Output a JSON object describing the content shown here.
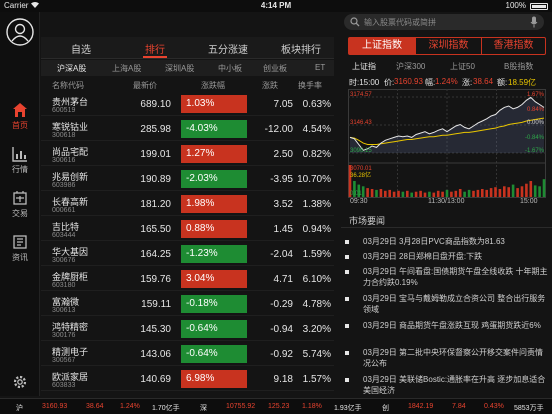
{
  "status_bar": {
    "carrier": "Carrier",
    "time": "4:14 PM",
    "battery": "100%"
  },
  "sidebar": {
    "items": [
      {
        "label": "首页",
        "icon": "home-icon",
        "active": true
      },
      {
        "label": "行情",
        "icon": "chart-icon",
        "active": false
      },
      {
        "label": "交易",
        "icon": "trade-icon",
        "active": false
      },
      {
        "label": "资讯",
        "icon": "news-icon",
        "active": false
      }
    ]
  },
  "main_tabs": [
    {
      "label": "自选",
      "active": false
    },
    {
      "label": "排行",
      "active": true
    },
    {
      "label": "五分涨速",
      "active": false
    },
    {
      "label": "板块排行",
      "active": false
    }
  ],
  "sub_tabs": [
    {
      "label": "沪深A股",
      "active": true
    },
    {
      "label": "上海A股",
      "active": false
    },
    {
      "label": "深圳A股",
      "active": false
    },
    {
      "label": "中小板",
      "active": false
    },
    {
      "label": "创业板",
      "active": false
    },
    {
      "label": "ET",
      "active": false
    }
  ],
  "columns": {
    "name": "名称代码",
    "price": "最新价",
    "change": "涨跌幅",
    "amount": "涨跌",
    "turnover": "换手率"
  },
  "stocks": [
    {
      "name": "贵州茅台",
      "code": "600519",
      "price": "689.10",
      "change": "1.03%",
      "dir": "up",
      "amount": "7.05",
      "turnover": "0.63%"
    },
    {
      "name": "寒锐钴业",
      "code": "300618",
      "price": "285.98",
      "change": "-4.03%",
      "dir": "down",
      "amount": "-12.00",
      "turnover": "4.54%"
    },
    {
      "name": "尚品宅配",
      "code": "300616",
      "price": "199.01",
      "change": "1.27%",
      "dir": "up",
      "amount": "2.50",
      "turnover": "0.82%"
    },
    {
      "name": "兆易创新",
      "code": "603986",
      "price": "190.89",
      "change": "-2.03%",
      "dir": "down",
      "amount": "-3.95",
      "turnover": "10.70%"
    },
    {
      "name": "长春高新",
      "code": "000661",
      "price": "181.20",
      "change": "1.98%",
      "dir": "up",
      "amount": "3.52",
      "turnover": "1.38%"
    },
    {
      "name": "吉比特",
      "code": "603444",
      "price": "165.50",
      "change": "0.88%",
      "dir": "up",
      "amount": "1.45",
      "turnover": "0.94%"
    },
    {
      "name": "华大基因",
      "code": "300676",
      "price": "164.25",
      "change": "-1.23%",
      "dir": "down",
      "amount": "-2.04",
      "turnover": "1.59%"
    },
    {
      "name": "金牌厨柜",
      "code": "603180",
      "price": "159.76",
      "change": "3.04%",
      "dir": "up",
      "amount": "4.71",
      "turnover": "6.10%"
    },
    {
      "name": "富瀚微",
      "code": "300613",
      "price": "159.11",
      "change": "-0.18%",
      "dir": "down",
      "amount": "-0.29",
      "turnover": "4.78%"
    },
    {
      "name": "鸿特精密",
      "code": "300176",
      "price": "145.30",
      "change": "-0.64%",
      "dir": "down",
      "amount": "-0.94",
      "turnover": "3.20%"
    },
    {
      "name": "精测电子",
      "code": "300567",
      "price": "143.06",
      "change": "-0.64%",
      "dir": "down",
      "amount": "-0.92",
      "turnover": "5.74%"
    },
    {
      "name": "欧派家居",
      "code": "603833",
      "price": "140.69",
      "change": "6.98%",
      "dir": "up",
      "amount": "9.18",
      "turnover": "1.57%"
    }
  ],
  "search": {
    "placeholder": "输入股票代码或简拼"
  },
  "index_tabs": [
    {
      "label": "上证指数",
      "active": true
    },
    {
      "label": "深圳指数",
      "active": false
    },
    {
      "label": "香港指数",
      "active": false
    }
  ],
  "index_sub": [
    {
      "label": "上证指",
      "active": true
    },
    {
      "label": "沪深300",
      "active": false
    },
    {
      "label": "上证50",
      "active": false
    },
    {
      "label": "B股指数",
      "active": false
    }
  ],
  "quote": {
    "time": "时:15:00",
    "price_label": "价:",
    "price": "3160.93",
    "rate_label": "幅:",
    "rate": "1.24%",
    "chg_label": "涨:",
    "chg": "38.64",
    "vol_label": "额:",
    "vol": "18.59亿"
  },
  "chart_data": {
    "type": "line",
    "price_levels": [
      "3174.57",
      "3146.43",
      "3096.15"
    ],
    "pct_levels": [
      "1.67%",
      "0.84%",
      "0.00%",
      "-0.84%",
      "-1.67%"
    ],
    "vol_levels": [
      "3070.01",
      "36.28亿",
      "0.01"
    ],
    "times": [
      "09:30",
      "11:30/13:00",
      "15:00"
    ],
    "price_series": [
      3118,
      3116,
      3108,
      3100,
      3102,
      3106,
      3104,
      3110,
      3114,
      3116,
      3118,
      3120,
      3119,
      3120,
      3118,
      3122,
      3124,
      3126,
      3123,
      3125,
      3128,
      3130,
      3126,
      3130,
      3134,
      3136,
      3132,
      3130,
      3134,
      3138,
      3141,
      3144,
      3148,
      3150,
      3156,
      3160,
      3162,
      3158,
      3160,
      3164,
      3170,
      3174,
      3168,
      3164,
      3160
    ],
    "avg_series": [
      3118,
      3117,
      3114,
      3110,
      3108,
      3108,
      3108,
      3109,
      3110,
      3111,
      3112,
      3113,
      3114,
      3115,
      3115,
      3116,
      3117,
      3118,
      3119,
      3119,
      3120,
      3121,
      3121,
      3122,
      3123,
      3124,
      3125,
      3125,
      3126,
      3127,
      3128,
      3129,
      3130,
      3131,
      3133,
      3134,
      3136,
      3137,
      3138,
      3139,
      3141,
      3142,
      3143,
      3144,
      3145
    ],
    "volume": [
      36,
      18,
      14,
      12,
      10,
      9,
      8,
      9,
      7,
      8,
      6,
      7,
      6,
      7,
      5,
      6,
      7,
      5,
      6,
      5,
      7,
      6,
      8,
      6,
      7,
      9,
      6,
      8,
      7,
      8,
      9,
      8,
      10,
      11,
      9,
      12,
      11,
      14,
      10,
      12,
      15,
      18,
      13,
      12,
      20
    ]
  },
  "news_header": "市场要闻",
  "news": [
    {
      "date": "03月29日",
      "text": "3月28日PVC商品指数为81.63"
    },
    {
      "date": "03月29日",
      "text": "28日郑棉日盘开盘:下跌"
    },
    {
      "date": "03月29日",
      "text": "午间看盘:国债期货午盘全线收跌 十年期主力合约跌0.19%"
    },
    {
      "date": "03月29日",
      "text": "宝马与戴姆勒成立合资公司 整合出行服务领域"
    },
    {
      "date": "03月29日",
      "text": "商品期货午盘涨跌互现 鸡蛋期货跌近6%"
    },
    {
      "date": "03月29日",
      "text": "第二批中央环保督察公开移交案件问责情况公布"
    },
    {
      "date": "03月29日",
      "text": "美联储Bostic:通胀率在升高 逐步加息适合美国经济"
    }
  ],
  "ticker": {
    "sh_label": "沪",
    "sh_price": "3160.93",
    "sh_chg": "38.64",
    "sh_pct": "1.24%",
    "sh_vol": "1.70亿手",
    "sz_label": "深",
    "sz_price": "10755.92",
    "sz_chg": "125.23",
    "sz_pct": "1.18%",
    "sz_vol": "1.93亿手",
    "cy_label": "创",
    "cy_price": "1842.19",
    "cy_chg": "7.84",
    "cy_pct": "0.43%",
    "cy_vol": "5853万手"
  }
}
